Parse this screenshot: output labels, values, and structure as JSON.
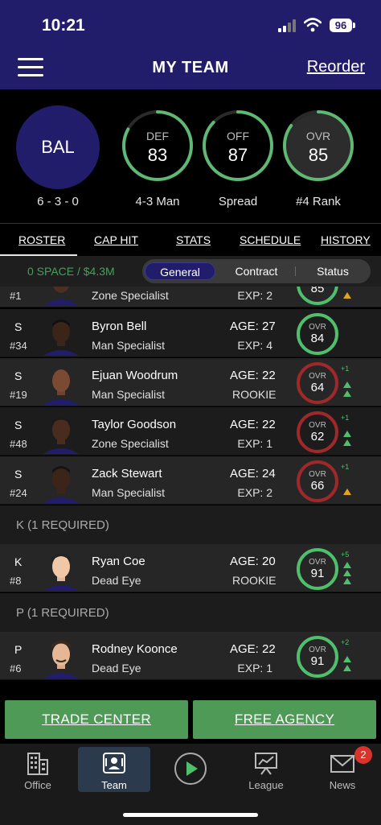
{
  "status_bar": {
    "time": "10:21",
    "battery": "96"
  },
  "header": {
    "title": "MY TEAM",
    "reorder_label": "Reorder"
  },
  "team": {
    "abbr": "BAL",
    "record": "6 - 3 - 0",
    "rings": [
      {
        "label": "DEF",
        "value": "83",
        "caption": "4-3 Man",
        "fill": 0.83
      },
      {
        "label": "OFF",
        "value": "87",
        "caption": "Spread",
        "fill": 0.87
      },
      {
        "label": "OVR",
        "value": "85",
        "caption": "#4 Rank",
        "fill": 0.85
      }
    ],
    "ring_color": "#5fb873"
  },
  "tabs": [
    "ROSTER",
    "CAP HIT",
    "STATS",
    "SCHEDULE",
    "HISTORY"
  ],
  "subbar": {
    "cap_space": "0 SPACE / $4.3M",
    "segments": [
      "General",
      "Contract",
      "Status"
    ]
  },
  "partial_row": {
    "num": "#1",
    "trait": "Zone Specialist",
    "exp": "EXP: 2",
    "ovr": "85"
  },
  "players": [
    {
      "pos": "S",
      "num": "#34",
      "name": "Byron Bell",
      "trait": "Man Specialist",
      "age": "AGE: 27",
      "exp": "EXP: 4",
      "ovr_label": "OVR",
      "ovr": "84",
      "ring": "green",
      "trend": ""
    },
    {
      "pos": "S",
      "num": "#19",
      "name": "Ejuan Woodrum",
      "trait": "Man Specialist",
      "age": "AGE: 22",
      "exp": "ROOKIE",
      "ovr_label": "OVR",
      "ovr": "64",
      "ring": "red",
      "trend": "+1"
    },
    {
      "pos": "S",
      "num": "#48",
      "name": "Taylor Goodson",
      "trait": "Zone Specialist",
      "age": "AGE: 22",
      "exp": "EXP: 1",
      "ovr_label": "OVR",
      "ovr": "62",
      "ring": "red",
      "trend": "+1"
    },
    {
      "pos": "S",
      "num": "#24",
      "name": "Zack Stewart",
      "trait": "Man Specialist",
      "age": "AGE: 24",
      "exp": "EXP: 2",
      "ovr_label": "OVR",
      "ovr": "66",
      "ring": "red",
      "trend": "+1"
    }
  ],
  "sections": [
    {
      "title": "K (1 REQUIRED)",
      "player": {
        "pos": "K",
        "num": "#8",
        "name": "Ryan Coe",
        "trait": "Dead Eye",
        "age": "AGE: 20",
        "exp": "ROOKIE",
        "ovr_label": "OVR",
        "ovr": "91",
        "ring": "green",
        "trend": "+5"
      }
    },
    {
      "title": "P (1 REQUIRED)",
      "player": {
        "pos": "P",
        "num": "#6",
        "name": "Rodney Koonce",
        "trait": "Dead Eye",
        "age": "AGE: 22",
        "exp": "EXP: 1",
        "ovr_label": "OVR",
        "ovr": "91",
        "ring": "green",
        "trend": "+2"
      }
    }
  ],
  "actions": {
    "trade": "TRADE CENTER",
    "free_agency": "FREE AGENCY"
  },
  "nav": {
    "items": [
      {
        "label": "Office",
        "icon": "office-building-icon"
      },
      {
        "label": "Team",
        "icon": "team-roster-icon"
      },
      {
        "label": "",
        "icon": "play-icon"
      },
      {
        "label": "League",
        "icon": "league-chart-icon"
      },
      {
        "label": "News",
        "icon": "mail-icon"
      }
    ],
    "news_badge": "2"
  },
  "colors": {
    "header": "#221d6b",
    "green": "#4fbf6e",
    "red": "#a0282a",
    "action": "#4f9a57",
    "warn": "#e0a423"
  }
}
